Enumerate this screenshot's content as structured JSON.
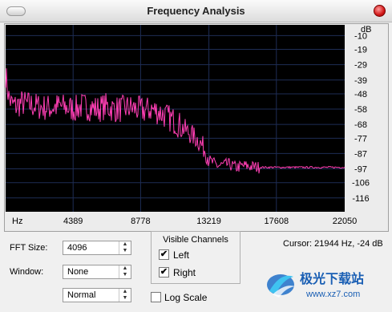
{
  "window": {
    "title": "Frequency Analysis"
  },
  "chart_data": {
    "type": "line",
    "title": "",
    "xlabel": "Hz",
    "ylabel": "dB",
    "x_ticks": [
      "4389",
      "8778",
      "13219",
      "17608",
      "22050"
    ],
    "y_ticks": [
      "-10",
      "-19",
      "-29",
      "-39",
      "-48",
      "-58",
      "-68",
      "-77",
      "-87",
      "-97",
      "-106",
      "-116"
    ],
    "xlim": [
      0,
      22050
    ],
    "ylim": [
      -125,
      -3
    ],
    "grid": true,
    "series": [
      {
        "x": [
          0,
          200,
          400,
          700,
          1000,
          1500,
          2000,
          2500,
          3000,
          3500,
          4000,
          4500,
          5000,
          5500,
          6000,
          6500,
          7000,
          7500,
          8000,
          8500,
          9000,
          9500,
          10000,
          10500,
          11000,
          11500,
          12000,
          12500,
          13000,
          13300,
          13800,
          14500,
          15000,
          15500,
          16500,
          17000,
          18000,
          19000,
          20000,
          21000,
          22050
        ],
        "y": [
          -35,
          -50,
          -55,
          -56,
          -54,
          -55,
          -56,
          -57,
          -57,
          -56,
          -57,
          -58,
          -56,
          -57,
          -58,
          -56,
          -58,
          -58,
          -57,
          -58,
          -59,
          -58,
          -60,
          -63,
          -66,
          -70,
          -74,
          -78,
          -85,
          -92,
          -95,
          -94,
          -96,
          -95,
          -96,
          -96,
          -96,
          -96,
          -96,
          -96,
          -96
        ]
      }
    ],
    "colors": {
      "background": "#000000",
      "grid": "#1e2d55",
      "line": "#ff3fb4"
    }
  },
  "controls": {
    "fft_label": "FFT Size:",
    "fft_value": "4096",
    "window_label": "Window:",
    "window_value": "None",
    "mode_value": "Normal",
    "channels_title": "Visible Channels",
    "left_label": "Left",
    "right_label": "Right",
    "left_checked": true,
    "right_checked": true,
    "logscale_label": "Log Scale",
    "logscale_checked": false,
    "cursor_text": "Cursor: 21944 Hz, -24 dB",
    "check_mark": "✔"
  },
  "watermark": {
    "text": "极光下载站",
    "url": "www.xz7.com"
  }
}
